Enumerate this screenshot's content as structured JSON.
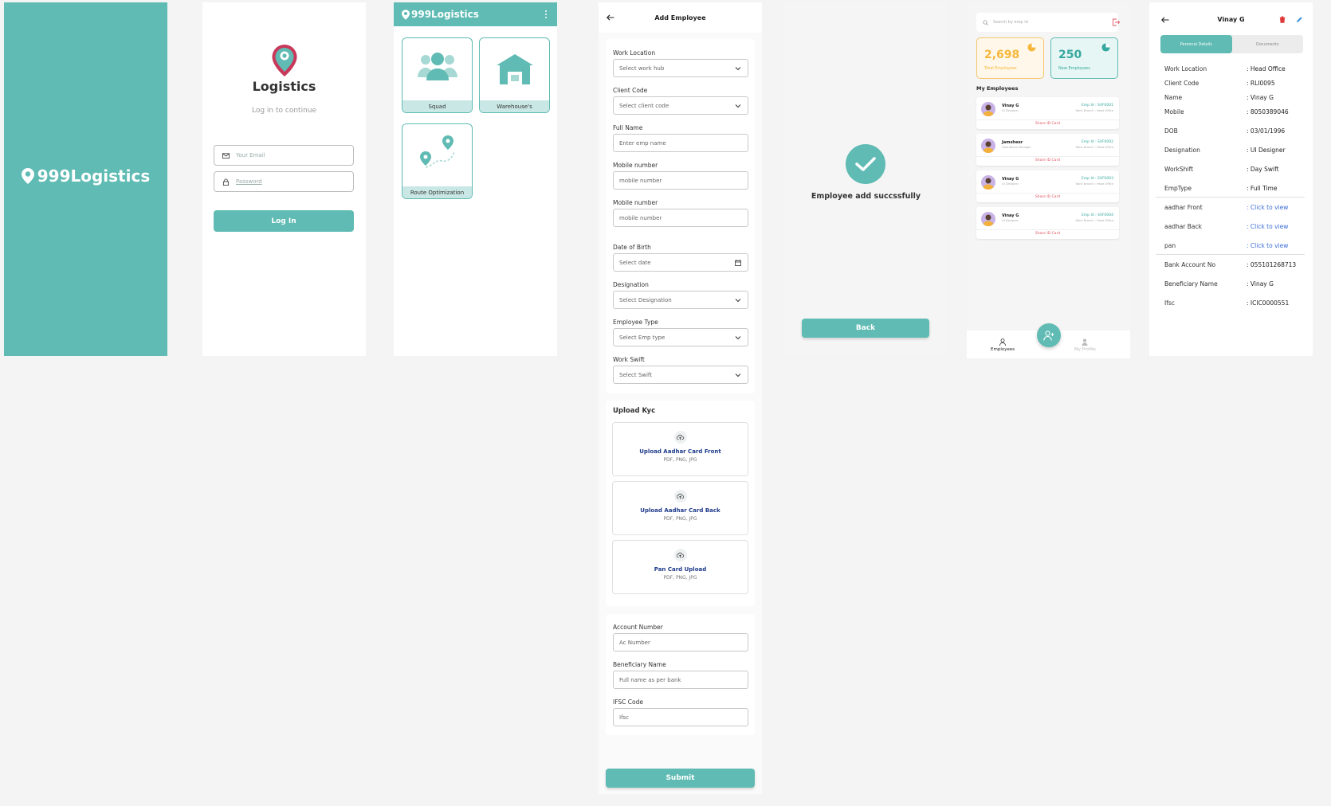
{
  "colors": {
    "teal": "#5fbbb3",
    "light_teal": "#c9e8e5",
    "pin_red": "#c8385a"
  },
  "splash": {
    "logo_text": "999Logistics"
  },
  "login": {
    "brand": "Logistics",
    "subtitle": "Log in to continue",
    "email_placeholder": "Your Email",
    "password_placeholder": "Password",
    "login_button": "Log In"
  },
  "home": {
    "brand": "999Logistics",
    "tiles": [
      {
        "label": "Squad",
        "icon": "people-icon"
      },
      {
        "label": "Warehouse's",
        "icon": "warehouse-icon"
      },
      {
        "label": "Route Optimization",
        "icon": "route-icon"
      }
    ]
  },
  "add_employee": {
    "title": "Add Employee",
    "fields": [
      {
        "label": "Work Location",
        "placeholder": "Select work hub",
        "kind": "dropdown"
      },
      {
        "label": "Client Code",
        "placeholder": "Select client code",
        "kind": "dropdown"
      },
      {
        "label": "Full Name",
        "placeholder": "Enter emp name",
        "kind": "text"
      },
      {
        "label": "Mobile number",
        "placeholder": "mobile number",
        "kind": "text"
      },
      {
        "label": "Mobile number",
        "placeholder": "mobile number",
        "kind": "text"
      },
      {
        "label": "Date of Birth",
        "placeholder": "Select date",
        "kind": "date"
      },
      {
        "label": "Designation",
        "placeholder": "Select Designation",
        "kind": "dropdown"
      },
      {
        "label": "Employee Type",
        "placeholder": "Select Emp type",
        "kind": "dropdown"
      },
      {
        "label": "Work Swift",
        "placeholder": "Select Swift",
        "kind": "dropdown"
      }
    ],
    "upload_title": "Upload Kyc",
    "uploads": [
      {
        "title": "Upload Aadhar Card Front",
        "formats": "PDF, PNG, JPG"
      },
      {
        "title": "Upload Aadhar Card Back",
        "formats": "PDF, PNG, JPG"
      },
      {
        "title": "Pan Card Upload",
        "formats": "PDF, PNG, JPG"
      }
    ],
    "bank_fields": [
      {
        "label": "Account Number",
        "placeholder": "Ac Number"
      },
      {
        "label": "Beneficiary Name",
        "placeholder": "Full name as per bank"
      },
      {
        "label": "IFSC Code",
        "placeholder": "Ifsc"
      }
    ],
    "submit": "Submit"
  },
  "success": {
    "message": "Employee add succssfully",
    "back_button": "Back"
  },
  "employee_list": {
    "search_placeholder": "Search by emp id",
    "stats": [
      {
        "value": "2,698",
        "label": "Total Employees",
        "color": "#f6b73c"
      },
      {
        "value": "250",
        "label": "New Employees",
        "color": "#36a89f"
      }
    ],
    "section_title": "My Employees",
    "employees": [
      {
        "name": "Vinay G",
        "role": "UI Designer",
        "emp_id": "Emp Id : SVF0001",
        "branch": "Work Branch : Head Office",
        "action": "Share ID Card"
      },
      {
        "name": "Jamsheer",
        "role": "Operations Manager",
        "emp_id": "Emp Id : SVF0002",
        "branch": "Work Branch : Head Office",
        "action": "Share ID Card"
      },
      {
        "name": "Vinay G",
        "role": "UI Designer",
        "emp_id": "Emp Id : SVF0003",
        "branch": "Work Branch : Head Office",
        "action": "Share ID Card"
      },
      {
        "name": "Vinay G",
        "role": "UI Designer",
        "emp_id": "Emp Id : SVF0004",
        "branch": "Work Branch : Head Office",
        "action": "Share ID Card"
      }
    ],
    "nav": [
      {
        "label": "Employees"
      },
      {
        "label": "My Profile"
      }
    ]
  },
  "employee_detail": {
    "title": "Vinay G",
    "tabs": [
      "Personal Details",
      "Documents"
    ],
    "rows": [
      {
        "key": "Work Location",
        "value": ": Head Office"
      },
      {
        "key": "Client Code",
        "value": ": RLI0095"
      },
      {
        "key": "Name",
        "value": ": Vinay G"
      },
      {
        "key": "Mobile",
        "value": ": 8050389046"
      },
      {
        "key": "DOB",
        "value": ": 03/01/1996"
      },
      {
        "key": "Designation",
        "value": ": UI Designer"
      },
      {
        "key": "WorkShift",
        "value": ": Day Swift"
      },
      {
        "key": "EmpType",
        "value": ": Full Time"
      },
      {
        "key": "aadhar Front",
        "value": ": Click to view"
      },
      {
        "key": "aadhar Back",
        "value": ": Click to view"
      },
      {
        "key": "pan",
        "value": ": Click to view"
      },
      {
        "key": "Bank Account No",
        "value": ": 055101268713"
      },
      {
        "key": "Beneficiary Name",
        "value": ": Vinay G"
      },
      {
        "key": "Ifsc",
        "value": ": ICIC0000551"
      }
    ]
  }
}
